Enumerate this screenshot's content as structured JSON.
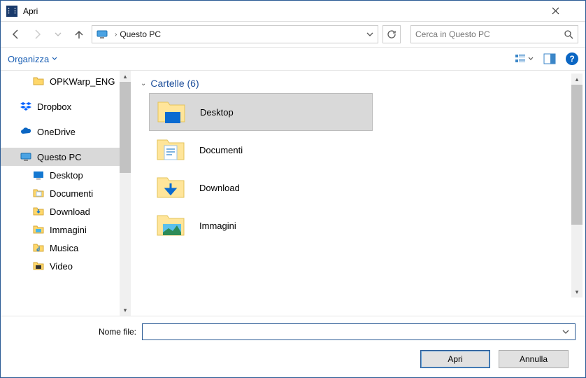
{
  "window": {
    "title": "Apri"
  },
  "nav": {
    "location": "Questo PC"
  },
  "search": {
    "placeholder": "Cerca in Questo PC"
  },
  "toolbar": {
    "organize": "Organizza"
  },
  "sidebar": {
    "items": [
      {
        "label": "OPKWarp_ENG"
      },
      {
        "label": "Dropbox"
      },
      {
        "label": "OneDrive"
      },
      {
        "label": "Questo PC"
      },
      {
        "label": "Desktop"
      },
      {
        "label": "Documenti"
      },
      {
        "label": "Download"
      },
      {
        "label": "Immagini"
      },
      {
        "label": "Musica"
      },
      {
        "label": "Video"
      }
    ]
  },
  "main": {
    "group_label": "Cartelle (6)",
    "items": [
      {
        "label": "Desktop"
      },
      {
        "label": "Documenti"
      },
      {
        "label": "Download"
      },
      {
        "label": "Immagini"
      }
    ]
  },
  "footer": {
    "filename_label": "Nome file:",
    "filename_value": "",
    "open": "Apri",
    "cancel": "Annulla"
  }
}
